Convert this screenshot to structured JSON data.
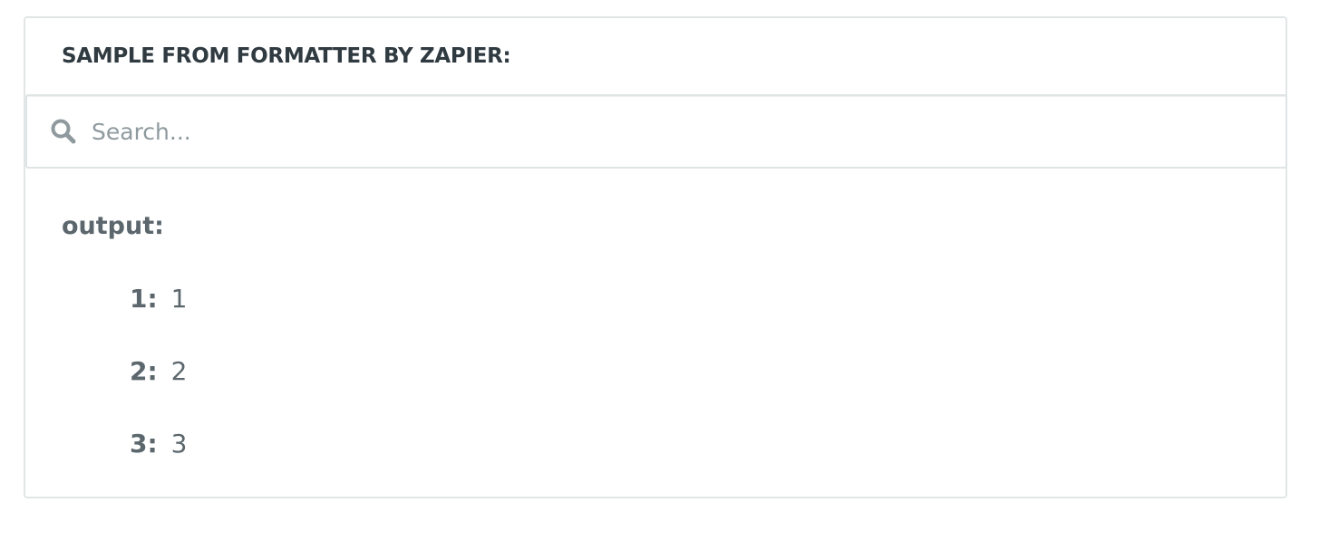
{
  "panel": {
    "title": "SAMPLE FROM FORMATTER BY ZAPIER:"
  },
  "search": {
    "placeholder": "Search...",
    "value": "",
    "icon": "search-icon"
  },
  "output": {
    "label": "output:",
    "items": [
      {
        "key": "1:",
        "value": "1"
      },
      {
        "key": "2:",
        "value": "2"
      },
      {
        "key": "3:",
        "value": "3"
      }
    ]
  },
  "colors": {
    "text_dark": "#2f3a41",
    "text_muted": "#5b676d",
    "placeholder": "#8f9a9f",
    "border": "#e2e6e7"
  }
}
